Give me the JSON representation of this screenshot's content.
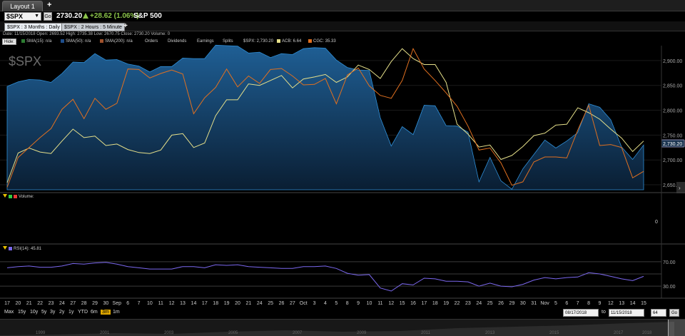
{
  "top_tabs": {
    "layout_label": "Layout 1",
    "add_label": "+"
  },
  "symbol_bar": {
    "symbol": "$SPX",
    "go_label": "Go",
    "price": "2730.20",
    "change": "+28.62 (1.06%)",
    "index_name": "S&P 500"
  },
  "chart_tabs": {
    "tabs": [
      {
        "label": "$SPX : 3 Months : Daily"
      },
      {
        "label": "$SPX : 2 Hours : 5 Minute"
      }
    ],
    "add_label": "+"
  },
  "info_line": "Date: 11/15/2018   Open: 2693.52   High: 2735.38   Low: 2670.75   Close: 2730.20   Volume: 0",
  "legend": {
    "hide_label": "Hide:",
    "items": [
      {
        "label": "SMA(15): n/a",
        "color": "#2e7d32"
      },
      {
        "label": "SMA(50): n/a",
        "color": "#1e4e8c"
      },
      {
        "label": "SMA(200): n/a",
        "color": "#a0522d"
      },
      {
        "label": "Orders"
      },
      {
        "label": "Dividends"
      },
      {
        "label": "Earnings"
      },
      {
        "label": "Splits"
      },
      {
        "label": "$SPX: 2,730.20",
        "color": "#1565c0"
      },
      {
        "label": "ACB: 6.64",
        "color": "#e6e08a"
      },
      {
        "label": "CGC: 35.33",
        "color": "#e07020"
      }
    ]
  },
  "watermark": "$SPX",
  "last_price_tag": "2,730.20",
  "volume_panel": {
    "label": "Volume:",
    "zero_label": "0"
  },
  "rsi_panel": {
    "label": "RSI(14): 45.81"
  },
  "zoom_buttons": [
    "Max",
    "15y",
    "10y",
    "5y",
    "3y",
    "2y",
    "1y",
    "YTD",
    "6m",
    "3m",
    "1m"
  ],
  "zoom_active": "3m",
  "date_range": {
    "from": "08/17/2018",
    "to_label": "to",
    "to": "11/15/2018",
    "points": "64",
    "go_label": "Go"
  },
  "navigator_years": [
    "1999",
    "2001",
    "2003",
    "2005",
    "2007",
    "2009",
    "2011",
    "2013",
    "2015",
    "2017",
    "2018"
  ],
  "colors": {
    "spx_fill": "#1f5f95",
    "acb_line": "#e6e08a",
    "cgc_line": "#e07020",
    "rsi_line": "#7b68ee"
  },
  "chart_data": {
    "type": "area",
    "x_ticks": [
      "17",
      "20",
      "21",
      "22",
      "23",
      "24",
      "27",
      "28",
      "29",
      "30",
      "Sep",
      "6",
      "7",
      "10",
      "11",
      "12",
      "13",
      "14",
      "17",
      "18",
      "19",
      "20",
      "21",
      "24",
      "25",
      "26",
      "27",
      "Oct",
      "3",
      "4",
      "5",
      "8",
      "9",
      "10",
      "11",
      "12",
      "15",
      "16",
      "17",
      "18",
      "19",
      "22",
      "23",
      "24",
      "25",
      "26",
      "29",
      "30",
      "31",
      "Nov",
      "5",
      "6",
      "7",
      "8",
      "9",
      "12",
      "13",
      "14",
      "15"
    ],
    "y_ticks": [
      "2,900.00",
      "2,850.00",
      "2,800.00",
      "2,750.00",
      "2,700.00",
      "2,650.00"
    ],
    "ylim": [
      2640,
      2930
    ],
    "series": [
      {
        "name": "$SPX",
        "values": [
          2848,
          2857,
          2862,
          2861,
          2856,
          2874,
          2897,
          2896,
          2914,
          2901,
          2902,
          2893,
          2889,
          2877,
          2888,
          2888,
          2905,
          2904,
          2904,
          2931,
          2930,
          2929,
          2915,
          2917,
          2906,
          2914,
          2912,
          2924,
          2926,
          2925,
          2901,
          2886,
          2881,
          2880,
          2785,
          2728,
          2767,
          2751,
          2810,
          2809,
          2769,
          2768,
          2756,
          2656,
          2705,
          2658,
          2641,
          2682,
          2711,
          2740,
          2724,
          2738,
          2755,
          2813,
          2806,
          2781,
          2726,
          2701,
          2730
        ]
      },
      {
        "name": "ACB: 6.64",
        "values": [
          2654,
          2714,
          2724,
          2716,
          2713,
          2738,
          2762,
          2745,
          2748,
          2729,
          2732,
          2721,
          2715,
          2713,
          2720,
          2750,
          2753,
          2725,
          2734,
          2789,
          2821,
          2821,
          2853,
          2850,
          2860,
          2870,
          2845,
          2863,
          2867,
          2872,
          2856,
          2867,
          2891,
          2882,
          2864,
          2898,
          2924,
          2904,
          2892,
          2892,
          2856,
          2772,
          2752,
          2726,
          2730,
          2701,
          2709,
          2727,
          2749,
          2754,
          2770,
          2772,
          2805,
          2795,
          2782,
          2762,
          2744,
          2717,
          2738
        ]
      },
      {
        "name": "CGC: 35.33",
        "values": [
          2645,
          2705,
          2725,
          2745,
          2763,
          2802,
          2822,
          2783,
          2824,
          2802,
          2814,
          2883,
          2882,
          2865,
          2874,
          2881,
          2873,
          2793,
          2825,
          2846,
          2883,
          2847,
          2869,
          2854,
          2882,
          2884,
          2869,
          2851,
          2852,
          2864,
          2813,
          2871,
          2885,
          2849,
          2830,
          2824,
          2860,
          2924,
          2883,
          2860,
          2835,
          2808,
          2768,
          2720,
          2724,
          2694,
          2649,
          2656,
          2696,
          2706,
          2706,
          2704,
          2760,
          2810,
          2729,
          2731,
          2725,
          2664,
          2677
        ]
      }
    ],
    "rsi": {
      "name": "RSI(14): 45.81",
      "y_ticks": [
        "70.00",
        "30.00"
      ],
      "ylim": [
        15,
        85
      ],
      "values": [
        60,
        62,
        63,
        61,
        61,
        63,
        67,
        66,
        68,
        69,
        66,
        62,
        60,
        58,
        58,
        58,
        62,
        62,
        60,
        65,
        64,
        65,
        62,
        61,
        60,
        59,
        59,
        62,
        62,
        63,
        59,
        51,
        48,
        49,
        27,
        22,
        34,
        32,
        43,
        42,
        38,
        38,
        37,
        30,
        35,
        30,
        29,
        33,
        40,
        44,
        42,
        44,
        45,
        52,
        50,
        46,
        42,
        39,
        46
      ]
    }
  }
}
